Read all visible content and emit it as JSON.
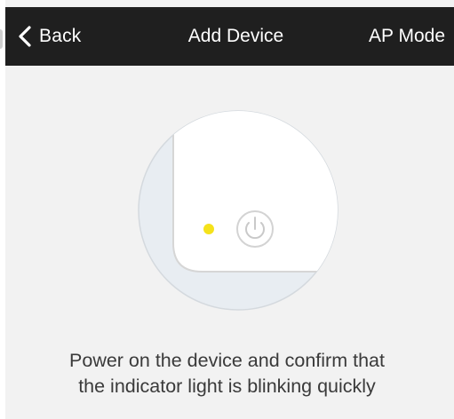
{
  "navbar": {
    "back_label": "Back",
    "back_icon": "chevron-left-icon",
    "title": "Add Device",
    "mode_label": "AP Mode"
  },
  "illustration": {
    "indicator_color": "#f5e21b",
    "power_icon": "power-icon"
  },
  "instruction": {
    "line1": "Power on the device and confirm that",
    "line2": "the indicator light is blinking quickly"
  },
  "colors": {
    "navbar_bg": "#1f1f1f",
    "page_bg": "#f2f2f2",
    "text": "#3a3a3a"
  }
}
